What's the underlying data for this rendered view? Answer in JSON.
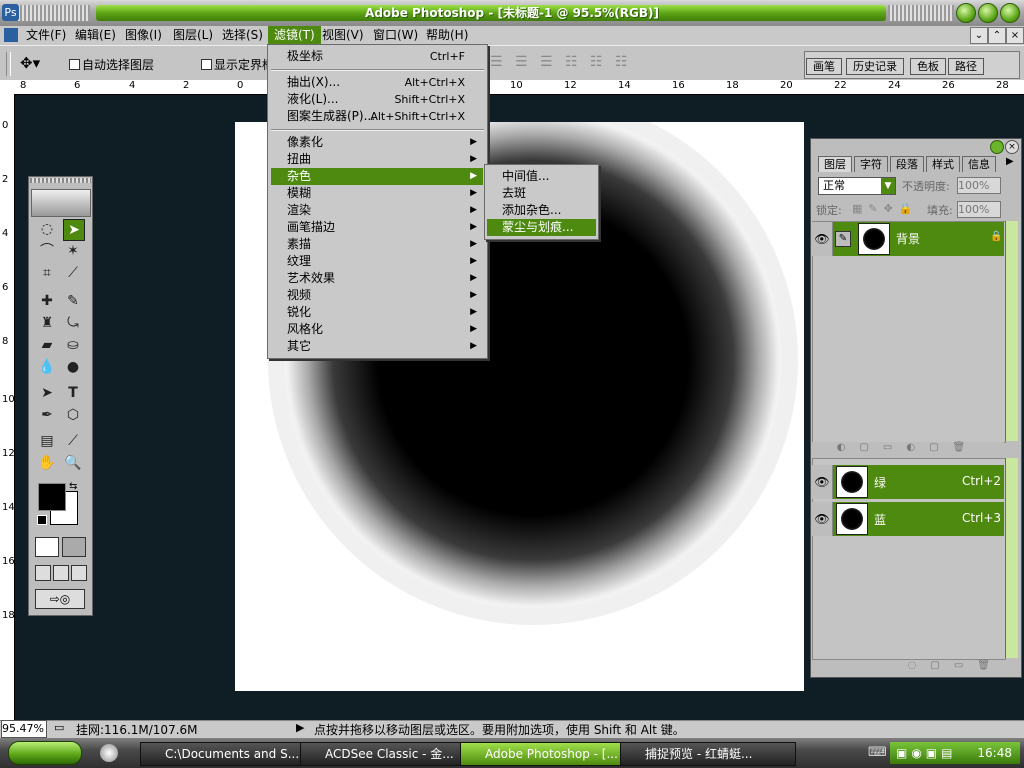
{
  "window": {
    "title": "Adobe Photoshop - [未标题-1 @ 95.5%(RGB)]"
  },
  "menu": [
    "文件(F)",
    "编辑(E)",
    "图像(I)",
    "图层(L)",
    "选择(S)",
    "滤镜(T)",
    "视图(V)",
    "窗口(W)",
    "帮助(H)"
  ],
  "options_bar": {
    "auto_select_label": "自动选择图层",
    "show_bounds_label": "显示定界框"
  },
  "palette_well": [
    "画笔",
    "历史记录",
    "色板",
    "路径"
  ],
  "ruler_h": [
    "8",
    "6",
    "4",
    "2",
    "0",
    "10",
    "12",
    "14",
    "16",
    "18",
    "20",
    "22",
    "24",
    "26",
    "28"
  ],
  "ruler_v": [
    "0",
    "2",
    "4",
    "6",
    "8",
    "10",
    "12",
    "14",
    "16",
    "18"
  ],
  "filter_menu": {
    "top": {
      "label": "极坐标",
      "shortcut": "Ctrl+F"
    },
    "group1": [
      {
        "label": "抽出(X)...",
        "shortcut": "Alt+Ctrl+X"
      },
      {
        "label": "液化(L)...",
        "shortcut": "Shift+Ctrl+X"
      },
      {
        "label": "图案生成器(P)...",
        "shortcut": "Alt+Shift+Ctrl+X"
      }
    ],
    "submenus": [
      "像素化",
      "扭曲",
      "杂色",
      "模糊",
      "渲染",
      "画笔描边",
      "素描",
      "纹理",
      "艺术效果",
      "视频",
      "锐化",
      "风格化",
      "其它"
    ],
    "active_submenu": "杂色"
  },
  "noise_submenu": {
    "items": [
      "中间值...",
      "去斑",
      "添加杂色...",
      "蒙尘与划痕..."
    ],
    "highlighted": "蒙尘与划痕..."
  },
  "layers_palette": {
    "tabs": [
      "图层",
      "字符",
      "段落",
      "样式",
      "信息"
    ],
    "blend_mode": "正常",
    "opacity_label": "不透明度:",
    "opacity_value": "100%",
    "lock_label": "锁定:",
    "fill_label": "填充:",
    "fill_value": "100%",
    "layers": [
      {
        "name": "背景"
      }
    ],
    "channels": [
      {
        "name": "绿",
        "shortcut": "Ctrl+2"
      },
      {
        "name": "蓝",
        "shortcut": "Ctrl+3"
      }
    ]
  },
  "status": {
    "zoom": "95.47%",
    "doc_size": "挂网:116.1M/107.6M",
    "hint": "点按并拖移以移动图层或选区。要用附加选项，使用 Shift 和 Alt 键。"
  },
  "taskbar": {
    "tasks": [
      "C:\\Documents and S...",
      "ACDSee Classic - 金...",
      "Adobe Photoshop - [...",
      "捕捉预览 - 红蜻蜓..."
    ],
    "active_task_index": 2,
    "clock": "16:48"
  },
  "colors": {
    "accent_green": "#4e8a0f",
    "workspace": "#0f1d24"
  }
}
